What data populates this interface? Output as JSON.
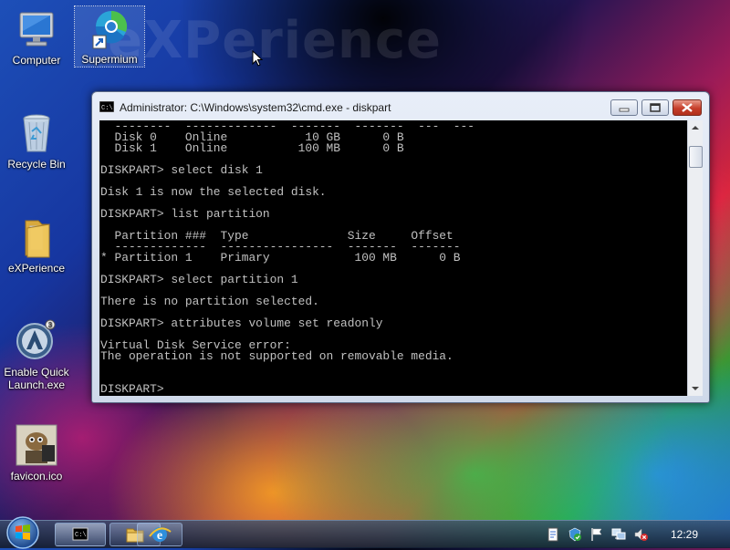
{
  "desktop": {
    "watermark": "eXPerience",
    "icons": [
      {
        "label": "Computer",
        "icon": "computer-icon"
      },
      {
        "label": "Supermium",
        "icon": "supermium-icon"
      },
      {
        "label": "Recycle Bin",
        "icon": "recycle-bin-icon"
      },
      {
        "label": "eXPerience",
        "icon": "folder-icon"
      },
      {
        "label": "Enable Quick Launch.exe",
        "icon": "quick-launch-exe-icon"
      },
      {
        "label": "favicon.ico",
        "icon": "favicon-image-icon"
      }
    ]
  },
  "window": {
    "title": "Administrator: C:\\Windows\\system32\\cmd.exe - diskpart",
    "console_text": "  --------  -------------  -------  -------  ---  ---\n  Disk 0    Online           10 GB      0 B\n  Disk 1    Online          100 MB      0 B\n\nDISKPART> select disk 1\n\nDisk 1 is now the selected disk.\n\nDISKPART> list partition\n\n  Partition ###  Type              Size     Offset\n  -------------  ----------------  -------  -------\n* Partition 1    Primary            100 MB      0 B\n\nDISKPART> select partition 1\n\nThere is no partition selected.\n\nDISKPART> attributes volume set readonly\n\nVirtual Disk Service error:\nThe operation is not supported on removable media.\n\n\nDISKPART> "
  },
  "taskbar": {
    "clock": "12:29",
    "buttons": [
      "cmd-taskbar-icon",
      "explorer-taskbar-icon",
      "ie-taskbar-icon"
    ],
    "tray": [
      "document-tray-icon",
      "security-tray-icon",
      "flag-tray-icon",
      "network-tray-icon",
      "volume-muted-tray-icon"
    ]
  },
  "colors": {
    "console_bg": "#000000",
    "console_text": "#c0c0c0"
  }
}
